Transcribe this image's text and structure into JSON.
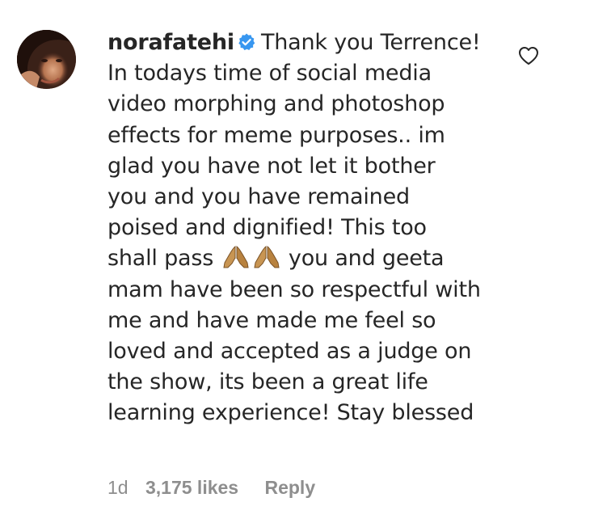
{
  "comment": {
    "username": "norafatehi",
    "verified": true,
    "lines": [
      "Thank you Terrence!",
      "In todays time of social media",
      "video morphing and photoshop",
      "effects for meme purposes.. im",
      "glad you have not let it bother",
      "you and you have remained",
      "poised and dignified! This too",
      "shall pass",
      "you and geeta",
      "mam have been so respectful with",
      "me and have made me feel so",
      "loved and accepted as a judge on",
      "the show, its been a great life",
      "learning experience! Stay blessed"
    ],
    "emoji": "folded-hands-emoji",
    "time": "1d",
    "likes": "3,175 likes",
    "reply_label": "Reply"
  },
  "icons": {
    "verified": "verified-badge-icon",
    "heart": "heart-outline-icon"
  },
  "colors": {
    "text": "#262626",
    "meta": "#8e8e8e",
    "verified_blue": "#3897f0"
  }
}
